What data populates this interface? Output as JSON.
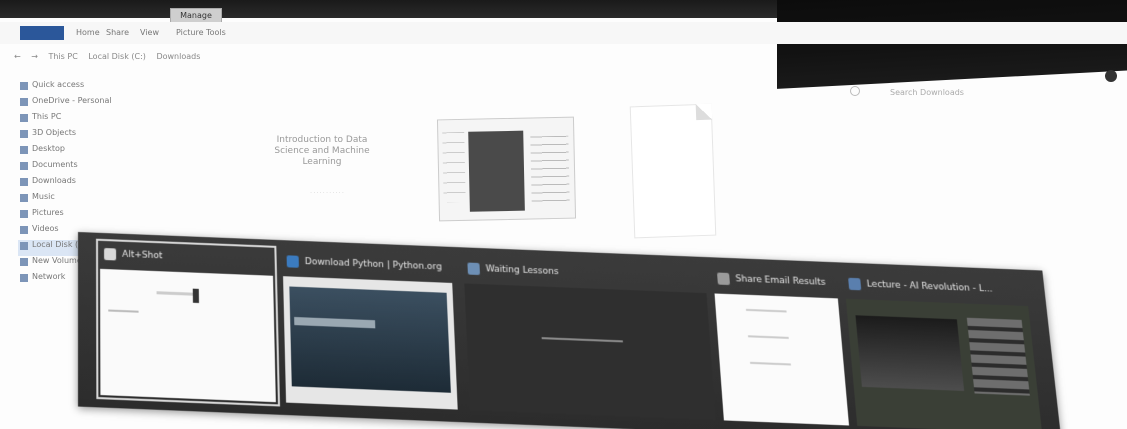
{
  "window": {
    "title_tab": "Manage"
  },
  "ribbon": {
    "tabs": [
      "Home",
      "Share",
      "View",
      "Picture Tools"
    ]
  },
  "address": {
    "crumbs": [
      "This PC",
      "Local Disk (C:)",
      "Downloads"
    ],
    "search_placeholder": "Search Downloads"
  },
  "sidebar": {
    "items": [
      {
        "label": "Quick access",
        "icon": "star-icon"
      },
      {
        "label": "OneDrive - Personal",
        "icon": "cloud-icon"
      },
      {
        "label": "This PC",
        "icon": "computer-icon"
      },
      {
        "label": "3D Objects",
        "icon": "cube-icon"
      },
      {
        "label": "Desktop",
        "icon": "desktop-icon"
      },
      {
        "label": "Documents",
        "icon": "document-icon"
      },
      {
        "label": "Downloads",
        "icon": "download-icon"
      },
      {
        "label": "Music",
        "icon": "music-icon"
      },
      {
        "label": "Pictures",
        "icon": "picture-icon"
      },
      {
        "label": "Videos",
        "icon": "video-icon"
      },
      {
        "label": "Local Disk (C:)",
        "icon": "drive-icon"
      },
      {
        "label": "New Volume (D:)",
        "icon": "drive-icon"
      },
      {
        "label": "Network",
        "icon": "network-icon"
      }
    ]
  },
  "files": {
    "doc_title": "Introduction to Data Science and Machine Learning"
  },
  "switcher": {
    "windows": [
      {
        "title": "Alt+Shot",
        "icon_color": "#d9d9d9"
      },
      {
        "title": "Download Python | Python.org",
        "icon_color": "#3b7bbf"
      },
      {
        "title": "Waiting Lessons",
        "icon_color": "#6d8fb5"
      },
      {
        "title": "Share Email Results",
        "icon_color": "#9a9a9a"
      },
      {
        "title": "Lecture - AI Revolution - L...",
        "icon_color": "#5a7fae"
      }
    ]
  },
  "colors": {
    "accent": "#2b579a",
    "switcher_bg": "#2f2f2f"
  }
}
